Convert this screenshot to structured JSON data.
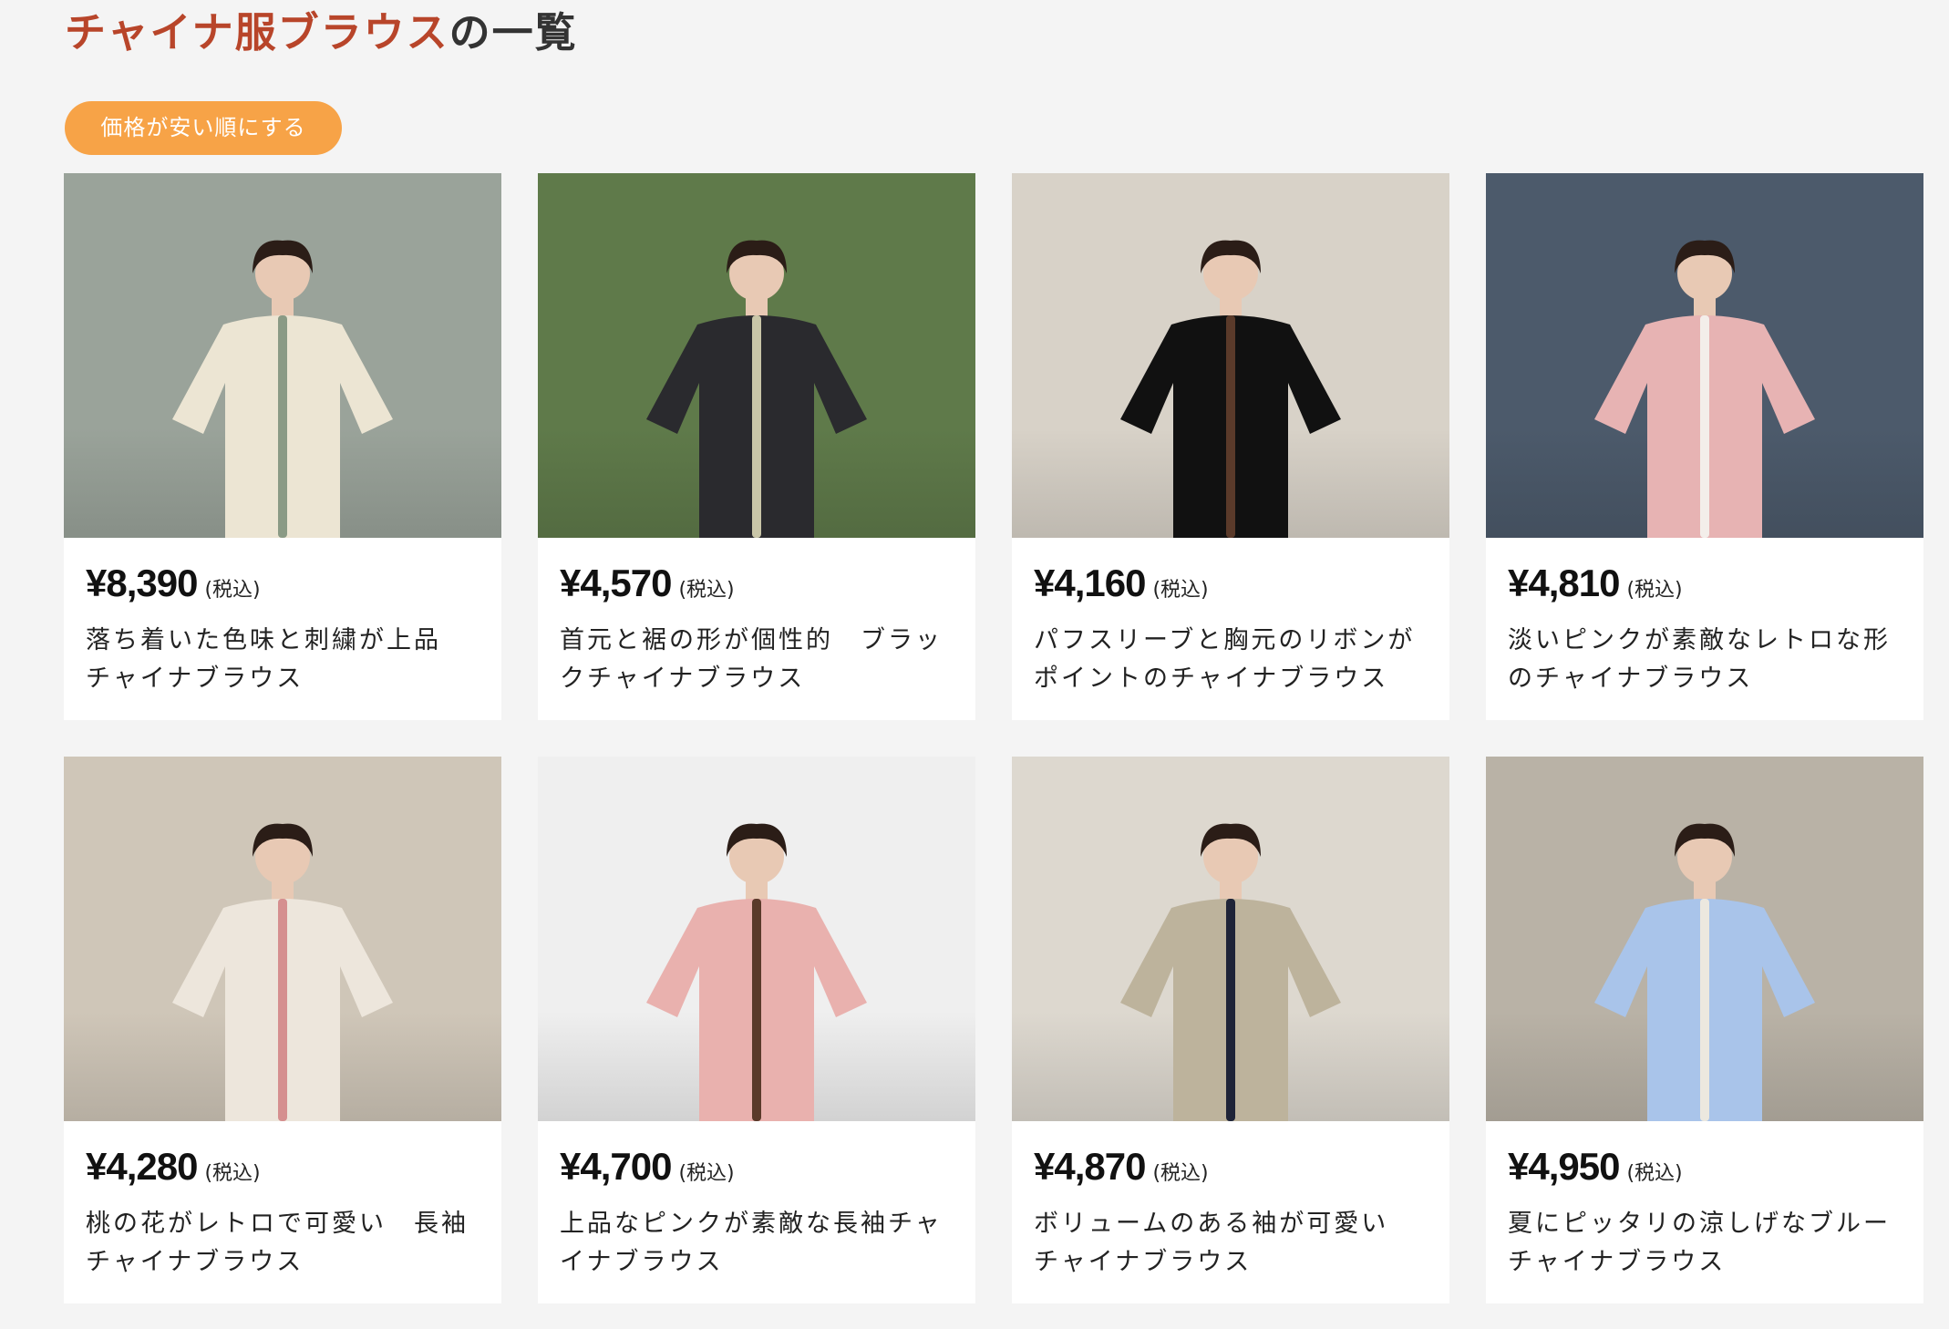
{
  "header": {
    "title_accent": "チャイナ服ブラウス",
    "title_rest": "の一覧"
  },
  "sort_button": {
    "label": "価格が安い順にする"
  },
  "products": [
    {
      "price": "¥8,390",
      "tax_label": "(税込)",
      "name": "落ち着いた色味と刺繍が上品　チャイナブラウス",
      "colors": {
        "bg": "#9aa39a",
        "garment": "#ece5d3",
        "accent": "#8a9a85"
      }
    },
    {
      "price": "¥4,570",
      "tax_label": "(税込)",
      "name": "首元と裾の形が個性的　ブラックチャイナブラウス",
      "colors": {
        "bg": "#5f7a4a",
        "garment": "#2a2a2e",
        "accent": "#c9c6a8"
      }
    },
    {
      "price": "¥4,160",
      "tax_label": "(税込)",
      "name": "パフスリーブと胸元のリボンがポイントのチャイナブラウス",
      "colors": {
        "bg": "#d8d2c8",
        "garment": "#111111",
        "accent": "#5a3a2a"
      }
    },
    {
      "price": "¥4,810",
      "tax_label": "(税込)",
      "name": "淡いピンクが素敵なレトロな形のチャイナブラウス",
      "colors": {
        "bg": "#4c5a6b",
        "garment": "#e7b3b3",
        "accent": "#f3eeea"
      }
    },
    {
      "price": "¥4,280",
      "tax_label": "(税込)",
      "name": "桃の花がレトロで可愛い　長袖チャイナブラウス",
      "colors": {
        "bg": "#cfc6b8",
        "garment": "#ede6dc",
        "accent": "#d58f8f"
      }
    },
    {
      "price": "¥4,700",
      "tax_label": "(税込)",
      "name": "上品なピンクが素敵な長袖チャイナブラウス",
      "colors": {
        "bg": "#efefef",
        "garment": "#e9b1ae",
        "accent": "#5a3a2a"
      }
    },
    {
      "price": "¥4,870",
      "tax_label": "(税込)",
      "name": "ボリュームのある袖が可愛い　チャイナブラウス",
      "colors": {
        "bg": "#ddd8cf",
        "garment": "#bdb39c",
        "accent": "#1f2438"
      }
    },
    {
      "price": "¥4,950",
      "tax_label": "(税込)",
      "name": "夏にピッタリの涼しげなブルーチャイナブラウス",
      "colors": {
        "bg": "#b9b2a6",
        "garment": "#a9c4ea",
        "accent": "#ece8df"
      }
    }
  ]
}
